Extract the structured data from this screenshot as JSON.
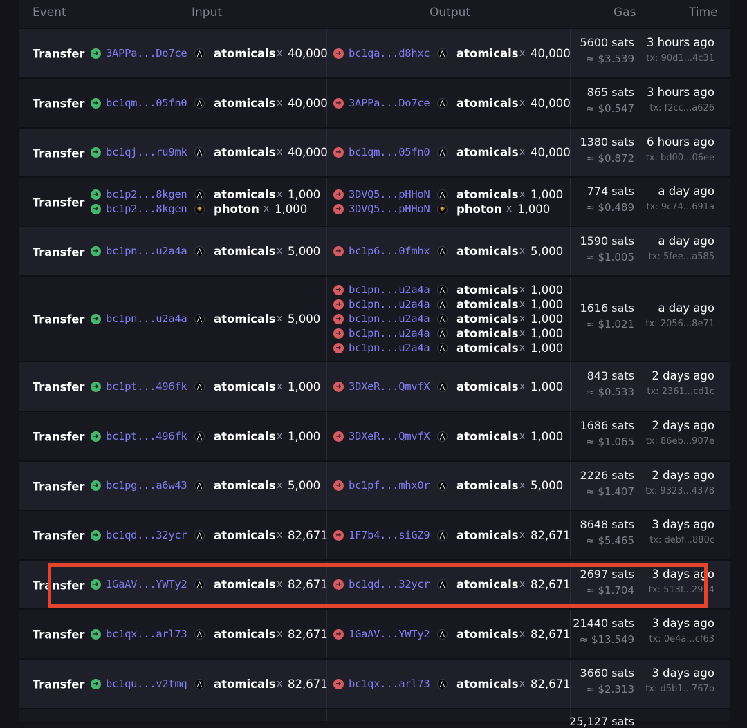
{
  "header": {
    "event": "Event",
    "input": "Input",
    "output": "Output",
    "gas": "Gas",
    "time": "Time"
  },
  "rows": [
    {
      "event": "Transfer",
      "gas": "5600 sats",
      "usd": "≈ $3.539",
      "time": "3 hours ago",
      "tx": "tx: 90d1...4c31",
      "inputs": [
        {
          "addr": "3APPa...Do7ce",
          "token": "atomicals",
          "amount": "40,000"
        }
      ],
      "outputs": [
        {
          "addr": "bc1qa...d8hxc",
          "token": "atomicals",
          "amount": "40,000"
        }
      ]
    },
    {
      "event": "Transfer",
      "gas": "865 sats",
      "usd": "≈ $0.547",
      "time": "3 hours ago",
      "tx": "tx: f2cc...a626",
      "inputs": [
        {
          "addr": "bc1qm...05fn0",
          "token": "atomicals",
          "amount": "40,000"
        }
      ],
      "outputs": [
        {
          "addr": "3APPa...Do7ce",
          "token": "atomicals",
          "amount": "40,000"
        }
      ]
    },
    {
      "event": "Transfer",
      "gas": "1380 sats",
      "usd": "≈ $0.872",
      "time": "6 hours ago",
      "tx": "tx: bd00...06ee",
      "inputs": [
        {
          "addr": "bc1qj...ru9mk",
          "token": "atomicals",
          "amount": "40,000"
        }
      ],
      "outputs": [
        {
          "addr": "bc1qm...05fn0",
          "token": "atomicals",
          "amount": "40,000"
        }
      ]
    },
    {
      "event": "Transfer",
      "gas": "774 sats",
      "usd": "≈ $0.489",
      "time": "a day ago",
      "tx": "tx: 9c74...691a",
      "inputs": [
        {
          "addr": "bc1p2...8kgen",
          "token": "atomicals",
          "amount": "1,000"
        },
        {
          "addr": "bc1p2...8kgen",
          "token": "photon",
          "amount": "1,000"
        }
      ],
      "outputs": [
        {
          "addr": "3DVQ5...pHHoN",
          "token": "atomicals",
          "amount": "1,000"
        },
        {
          "addr": "3DVQ5...pHHoN",
          "token": "photon",
          "amount": "1,000"
        }
      ]
    },
    {
      "event": "Transfer",
      "gas": "1590 sats",
      "usd": "≈ $1.005",
      "time": "a day ago",
      "tx": "tx: 5fee...a585",
      "inputs": [
        {
          "addr": "bc1pn...u2a4a",
          "token": "atomicals",
          "amount": "5,000"
        }
      ],
      "outputs": [
        {
          "addr": "bc1p6...0fmhx",
          "token": "atomicals",
          "amount": "5,000"
        }
      ]
    },
    {
      "event": "Transfer",
      "gas": "1616 sats",
      "usd": "≈ $1.021",
      "time": "a day ago",
      "tx": "tx: 2056...8e71",
      "inputs": [
        {
          "addr": "bc1pn...u2a4a",
          "token": "atomicals",
          "amount": "5,000"
        }
      ],
      "outputs": [
        {
          "addr": "bc1pn...u2a4a",
          "token": "atomicals",
          "amount": "1,000"
        },
        {
          "addr": "bc1pn...u2a4a",
          "token": "atomicals",
          "amount": "1,000"
        },
        {
          "addr": "bc1pn...u2a4a",
          "token": "atomicals",
          "amount": "1,000"
        },
        {
          "addr": "bc1pn...u2a4a",
          "token": "atomicals",
          "amount": "1,000"
        },
        {
          "addr": "bc1pn...u2a4a",
          "token": "atomicals",
          "amount": "1,000"
        }
      ]
    },
    {
      "event": "Transfer",
      "gas": "843 sats",
      "usd": "≈ $0.533",
      "time": "2 days ago",
      "tx": "tx: 2361...cd1c",
      "inputs": [
        {
          "addr": "bc1pt...496fk",
          "token": "atomicals",
          "amount": "1,000"
        }
      ],
      "outputs": [
        {
          "addr": "3DXeR...QmvfX",
          "token": "atomicals",
          "amount": "1,000"
        }
      ]
    },
    {
      "event": "Transfer",
      "gas": "1686 sats",
      "usd": "≈ $1.065",
      "time": "2 days ago",
      "tx": "tx: 86eb...907e",
      "inputs": [
        {
          "addr": "bc1pt...496fk",
          "token": "atomicals",
          "amount": "1,000"
        }
      ],
      "outputs": [
        {
          "addr": "3DXeR...QmvfX",
          "token": "atomicals",
          "amount": "1,000"
        }
      ]
    },
    {
      "event": "Transfer",
      "gas": "2226 sats",
      "usd": "≈ $1.407",
      "time": "2 days ago",
      "tx": "tx: 9323...4378",
      "inputs": [
        {
          "addr": "bc1pg...a6w43",
          "token": "atomicals",
          "amount": "5,000"
        }
      ],
      "outputs": [
        {
          "addr": "bc1pf...mhx0r",
          "token": "atomicals",
          "amount": "5,000"
        }
      ]
    },
    {
      "event": "Transfer",
      "gas": "8648 sats",
      "usd": "≈ $5.465",
      "time": "3 days ago",
      "tx": "tx: debf...880c",
      "inputs": [
        {
          "addr": "bc1qd...32ycr",
          "token": "atomicals",
          "amount": "82,671"
        }
      ],
      "outputs": [
        {
          "addr": "1F7b4...siGZ9",
          "token": "atomicals",
          "amount": "82,671"
        }
      ]
    },
    {
      "event": "Transfer",
      "gas": "2697 sats",
      "usd": "≈ $1.704",
      "time": "3 days ago",
      "tx": "tx: 513f...2934",
      "inputs": [
        {
          "addr": "1GaAV...YWTy2",
          "token": "atomicals",
          "amount": "82,671"
        }
      ],
      "outputs": [
        {
          "addr": "bc1qd...32ycr",
          "token": "atomicals",
          "amount": "82,671"
        }
      ]
    },
    {
      "event": "Transfer",
      "gas": "21440 sats",
      "usd": "≈ $13.549",
      "time": "3 days ago",
      "tx": "tx: 0e4a...cf63",
      "inputs": [
        {
          "addr": "bc1qx...arl73",
          "token": "atomicals",
          "amount": "82,671"
        }
      ],
      "outputs": [
        {
          "addr": "1GaAV...YWTy2",
          "token": "atomicals",
          "amount": "82,671"
        }
      ]
    },
    {
      "event": "Transfer",
      "gas": "3660 sats",
      "usd": "≈ $2.313",
      "time": "3 days ago",
      "tx": "tx: d5b1...767b",
      "inputs": [
        {
          "addr": "bc1qu...v2tmq",
          "token": "atomicals",
          "amount": "82,671"
        }
      ],
      "outputs": [
        {
          "addr": "bc1qx...arl73",
          "token": "atomicals",
          "amount": "82,671"
        }
      ]
    },
    {
      "event": "",
      "gas": "25,127 sats",
      "usd": "",
      "time": "",
      "tx": "",
      "inputs": [],
      "outputs": []
    }
  ],
  "highlighted_row": 10,
  "icons": {
    "input_direction": "arrow-right-in-icon",
    "output_direction": "arrow-right-out-icon",
    "atomicals": "atomicals-logo-icon",
    "photon": "photon-logo-icon"
  },
  "colors": {
    "address": "#7f7cf0",
    "input_dot": "#46b66d",
    "output_dot": "#d75a60",
    "highlight": "#e4432c"
  }
}
